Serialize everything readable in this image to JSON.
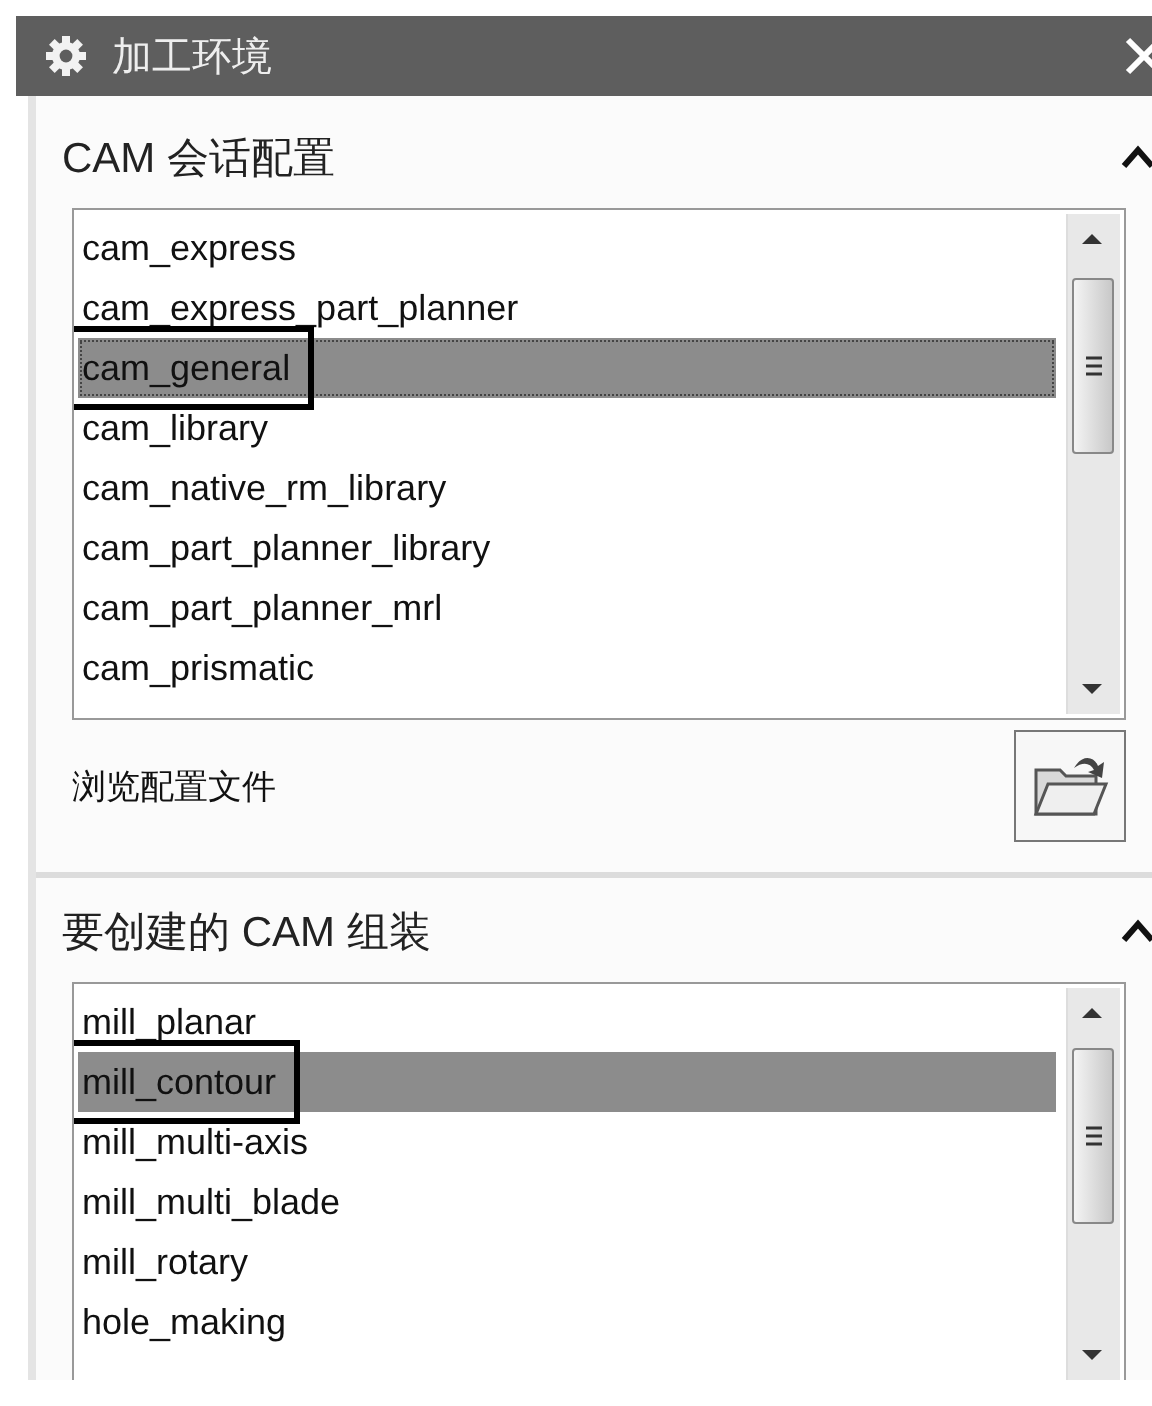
{
  "window": {
    "title": "加工环境"
  },
  "sections": [
    {
      "title": "CAM 会话配置",
      "expanded": true,
      "list": {
        "focused": true,
        "items": [
          {
            "label": "cam_express",
            "selected": false,
            "annotated": false
          },
          {
            "label": "cam_express_part_planner",
            "selected": false,
            "annotated": false
          },
          {
            "label": "cam_general",
            "selected": true,
            "annotated": true
          },
          {
            "label": "cam_library",
            "selected": false,
            "annotated": false
          },
          {
            "label": "cam_native_rm_library",
            "selected": false,
            "annotated": false
          },
          {
            "label": "cam_part_planner_library",
            "selected": false,
            "annotated": false
          },
          {
            "label": "cam_part_planner_mrl",
            "selected": false,
            "annotated": false
          },
          {
            "label": "cam_prismatic",
            "selected": false,
            "annotated": false
          }
        ]
      },
      "browse": {
        "label": "浏览配置文件"
      }
    },
    {
      "title": "要创建的 CAM 组装",
      "expanded": true,
      "list": {
        "focused": false,
        "items": [
          {
            "label": "mill_planar",
            "selected": false,
            "annotated": false
          },
          {
            "label": "mill_contour",
            "selected": true,
            "annotated": true
          },
          {
            "label": "mill_multi-axis",
            "selected": false,
            "annotated": false
          },
          {
            "label": "mill_multi_blade",
            "selected": false,
            "annotated": false
          },
          {
            "label": "mill_rotary",
            "selected": false,
            "annotated": false
          },
          {
            "label": "hole_making",
            "selected": false,
            "annotated": false
          }
        ]
      }
    }
  ]
}
